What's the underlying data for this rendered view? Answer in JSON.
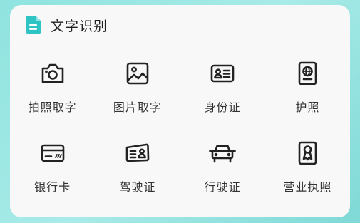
{
  "header": {
    "title": "文字识别",
    "icon": "document-icon",
    "accent_color": "#2ec4c4"
  },
  "tiles": [
    {
      "label": "拍照取字",
      "icon": "camera-icon"
    },
    {
      "label": "图片取字",
      "icon": "image-icon"
    },
    {
      "label": "身份证",
      "icon": "id-card-icon"
    },
    {
      "label": "护照",
      "icon": "passport-icon"
    },
    {
      "label": "银行卡",
      "icon": "bank-card-icon"
    },
    {
      "label": "驾驶证",
      "icon": "driver-license-icon"
    },
    {
      "label": "行驶证",
      "icon": "vehicle-license-icon"
    },
    {
      "label": "营业执照",
      "icon": "business-license-icon"
    }
  ]
}
